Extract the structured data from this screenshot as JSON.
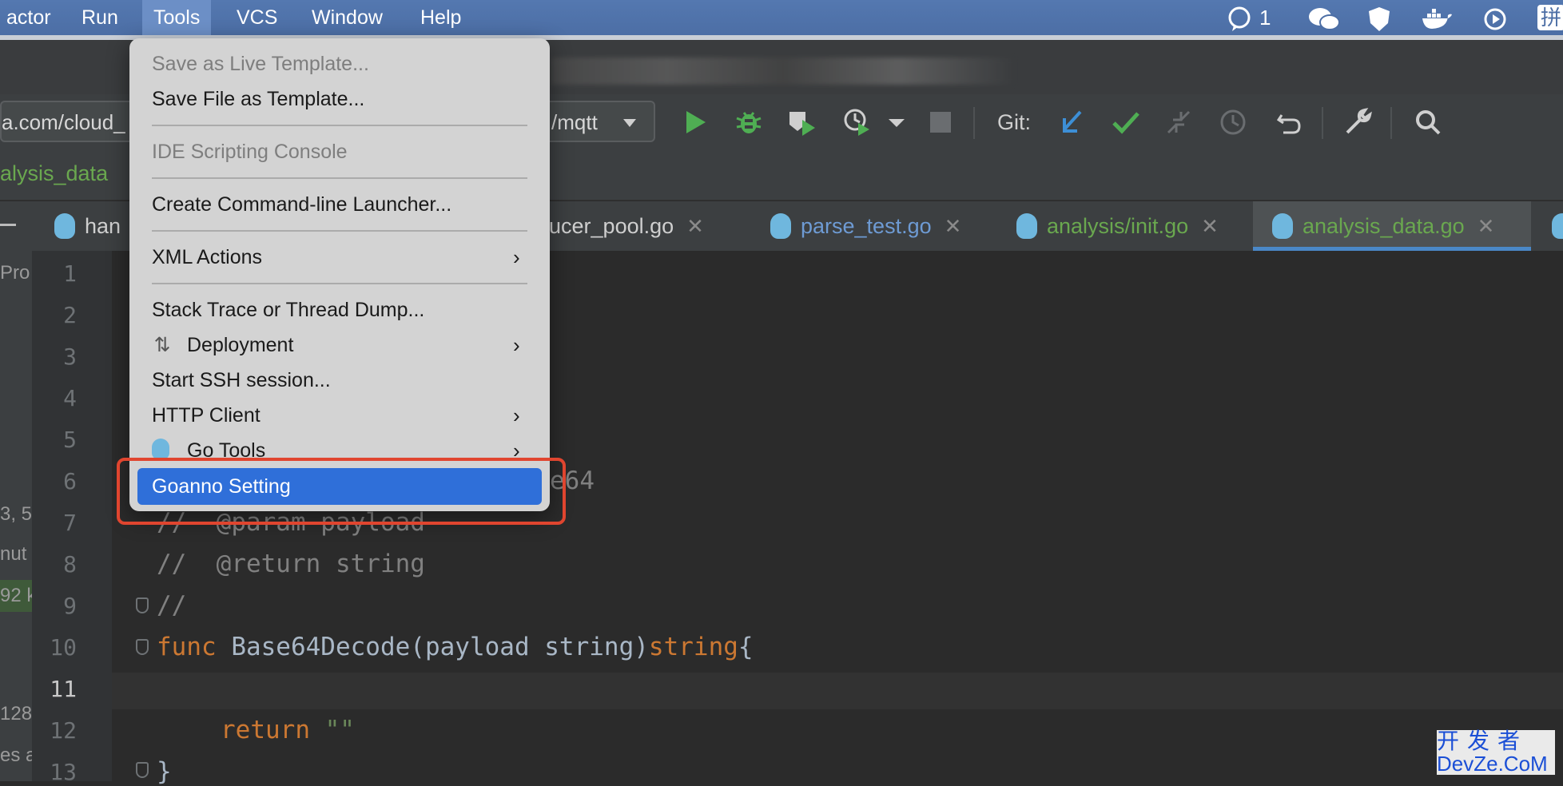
{
  "menubar": {
    "items": [
      "actor",
      "Run",
      "Tools",
      "VCS",
      "Window",
      "Help"
    ],
    "active": "Tools",
    "tray_count": "1",
    "tray_ime": "拼"
  },
  "toolbar": {
    "url_left": "a.com/cloud_",
    "url_right": "/mqtt",
    "git_label": "Git:"
  },
  "breadcrumb": "alysis_data",
  "tabs": [
    {
      "label": "han",
      "active": false
    },
    {
      "label": "ducer_pool.go",
      "active": false
    },
    {
      "label": "parse_test.go",
      "active": false
    },
    {
      "label": "analysis/init.go",
      "active": false
    },
    {
      "label": "analysis_data.go",
      "active": true
    }
  ],
  "left_strip": [
    "Pro",
    "3, 5",
    "nut",
    "92 k",
    "128",
    "es a"
  ],
  "menu": {
    "save_live_template": "Save as Live Template...",
    "save_file_template": "Save File as Template...",
    "ide_scripting": "IDE Scripting Console",
    "cmd_launcher": "Create Command-line Launcher...",
    "xml_actions": "XML Actions",
    "stack_trace": "Stack Trace or Thread Dump...",
    "deployment": "Deployment",
    "ssh_session": "Start SSH session...",
    "http_client": "HTTP Client",
    "go_tools": "Go Tools",
    "goanno": "Goanno Setting"
  },
  "editor": {
    "line_numbers": [
      "1",
      "2",
      "3",
      "4",
      "5",
      "6",
      "7",
      "8",
      "9",
      "10",
      "11",
      "12",
      "13"
    ],
    "current_line": "11",
    "line6_tail": "e64",
    "line7": "//  @param payload",
    "line8": "//  @return string",
    "line9": "//",
    "line10_kw": "func",
    "line10_name": " Base64Decode",
    "line10_params": "(payload string)",
    "line10_ret": "string",
    "line10_brace": "{",
    "line12_kw": "return",
    "line12_str": " \"\"",
    "line13": "}"
  },
  "watermark": {
    "line1": "开发者",
    "line2": "DevZe.CoM"
  }
}
